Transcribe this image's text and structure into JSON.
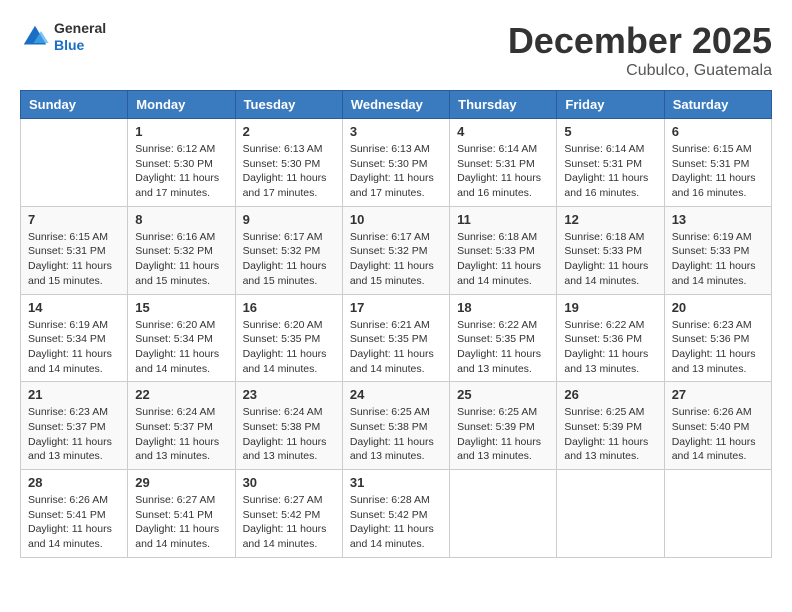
{
  "header": {
    "logo": {
      "general": "General",
      "blue": "Blue"
    },
    "title": "December 2025",
    "location": "Cubulco, Guatemala"
  },
  "weekdays": [
    "Sunday",
    "Monday",
    "Tuesday",
    "Wednesday",
    "Thursday",
    "Friday",
    "Saturday"
  ],
  "weeks": [
    [
      {
        "day": "",
        "sunrise": "",
        "sunset": "",
        "daylight": ""
      },
      {
        "day": "1",
        "sunrise": "Sunrise: 6:12 AM",
        "sunset": "Sunset: 5:30 PM",
        "daylight": "Daylight: 11 hours and 17 minutes."
      },
      {
        "day": "2",
        "sunrise": "Sunrise: 6:13 AM",
        "sunset": "Sunset: 5:30 PM",
        "daylight": "Daylight: 11 hours and 17 minutes."
      },
      {
        "day": "3",
        "sunrise": "Sunrise: 6:13 AM",
        "sunset": "Sunset: 5:30 PM",
        "daylight": "Daylight: 11 hours and 17 minutes."
      },
      {
        "day": "4",
        "sunrise": "Sunrise: 6:14 AM",
        "sunset": "Sunset: 5:31 PM",
        "daylight": "Daylight: 11 hours and 16 minutes."
      },
      {
        "day": "5",
        "sunrise": "Sunrise: 6:14 AM",
        "sunset": "Sunset: 5:31 PM",
        "daylight": "Daylight: 11 hours and 16 minutes."
      },
      {
        "day": "6",
        "sunrise": "Sunrise: 6:15 AM",
        "sunset": "Sunset: 5:31 PM",
        "daylight": "Daylight: 11 hours and 16 minutes."
      }
    ],
    [
      {
        "day": "7",
        "sunrise": "Sunrise: 6:15 AM",
        "sunset": "Sunset: 5:31 PM",
        "daylight": "Daylight: 11 hours and 15 minutes."
      },
      {
        "day": "8",
        "sunrise": "Sunrise: 6:16 AM",
        "sunset": "Sunset: 5:32 PM",
        "daylight": "Daylight: 11 hours and 15 minutes."
      },
      {
        "day": "9",
        "sunrise": "Sunrise: 6:17 AM",
        "sunset": "Sunset: 5:32 PM",
        "daylight": "Daylight: 11 hours and 15 minutes."
      },
      {
        "day": "10",
        "sunrise": "Sunrise: 6:17 AM",
        "sunset": "Sunset: 5:32 PM",
        "daylight": "Daylight: 11 hours and 15 minutes."
      },
      {
        "day": "11",
        "sunrise": "Sunrise: 6:18 AM",
        "sunset": "Sunset: 5:33 PM",
        "daylight": "Daylight: 11 hours and 14 minutes."
      },
      {
        "day": "12",
        "sunrise": "Sunrise: 6:18 AM",
        "sunset": "Sunset: 5:33 PM",
        "daylight": "Daylight: 11 hours and 14 minutes."
      },
      {
        "day": "13",
        "sunrise": "Sunrise: 6:19 AM",
        "sunset": "Sunset: 5:33 PM",
        "daylight": "Daylight: 11 hours and 14 minutes."
      }
    ],
    [
      {
        "day": "14",
        "sunrise": "Sunrise: 6:19 AM",
        "sunset": "Sunset: 5:34 PM",
        "daylight": "Daylight: 11 hours and 14 minutes."
      },
      {
        "day": "15",
        "sunrise": "Sunrise: 6:20 AM",
        "sunset": "Sunset: 5:34 PM",
        "daylight": "Daylight: 11 hours and 14 minutes."
      },
      {
        "day": "16",
        "sunrise": "Sunrise: 6:20 AM",
        "sunset": "Sunset: 5:35 PM",
        "daylight": "Daylight: 11 hours and 14 minutes."
      },
      {
        "day": "17",
        "sunrise": "Sunrise: 6:21 AM",
        "sunset": "Sunset: 5:35 PM",
        "daylight": "Daylight: 11 hours and 14 minutes."
      },
      {
        "day": "18",
        "sunrise": "Sunrise: 6:22 AM",
        "sunset": "Sunset: 5:35 PM",
        "daylight": "Daylight: 11 hours and 13 minutes."
      },
      {
        "day": "19",
        "sunrise": "Sunrise: 6:22 AM",
        "sunset": "Sunset: 5:36 PM",
        "daylight": "Daylight: 11 hours and 13 minutes."
      },
      {
        "day": "20",
        "sunrise": "Sunrise: 6:23 AM",
        "sunset": "Sunset: 5:36 PM",
        "daylight": "Daylight: 11 hours and 13 minutes."
      }
    ],
    [
      {
        "day": "21",
        "sunrise": "Sunrise: 6:23 AM",
        "sunset": "Sunset: 5:37 PM",
        "daylight": "Daylight: 11 hours and 13 minutes."
      },
      {
        "day": "22",
        "sunrise": "Sunrise: 6:24 AM",
        "sunset": "Sunset: 5:37 PM",
        "daylight": "Daylight: 11 hours and 13 minutes."
      },
      {
        "day": "23",
        "sunrise": "Sunrise: 6:24 AM",
        "sunset": "Sunset: 5:38 PM",
        "daylight": "Daylight: 11 hours and 13 minutes."
      },
      {
        "day": "24",
        "sunrise": "Sunrise: 6:25 AM",
        "sunset": "Sunset: 5:38 PM",
        "daylight": "Daylight: 11 hours and 13 minutes."
      },
      {
        "day": "25",
        "sunrise": "Sunrise: 6:25 AM",
        "sunset": "Sunset: 5:39 PM",
        "daylight": "Daylight: 11 hours and 13 minutes."
      },
      {
        "day": "26",
        "sunrise": "Sunrise: 6:25 AM",
        "sunset": "Sunset: 5:39 PM",
        "daylight": "Daylight: 11 hours and 13 minutes."
      },
      {
        "day": "27",
        "sunrise": "Sunrise: 6:26 AM",
        "sunset": "Sunset: 5:40 PM",
        "daylight": "Daylight: 11 hours and 14 minutes."
      }
    ],
    [
      {
        "day": "28",
        "sunrise": "Sunrise: 6:26 AM",
        "sunset": "Sunset: 5:41 PM",
        "daylight": "Daylight: 11 hours and 14 minutes."
      },
      {
        "day": "29",
        "sunrise": "Sunrise: 6:27 AM",
        "sunset": "Sunset: 5:41 PM",
        "daylight": "Daylight: 11 hours and 14 minutes."
      },
      {
        "day": "30",
        "sunrise": "Sunrise: 6:27 AM",
        "sunset": "Sunset: 5:42 PM",
        "daylight": "Daylight: 11 hours and 14 minutes."
      },
      {
        "day": "31",
        "sunrise": "Sunrise: 6:28 AM",
        "sunset": "Sunset: 5:42 PM",
        "daylight": "Daylight: 11 hours and 14 minutes."
      },
      {
        "day": "",
        "sunrise": "",
        "sunset": "",
        "daylight": ""
      },
      {
        "day": "",
        "sunrise": "",
        "sunset": "",
        "daylight": ""
      },
      {
        "day": "",
        "sunrise": "",
        "sunset": "",
        "daylight": ""
      }
    ]
  ]
}
